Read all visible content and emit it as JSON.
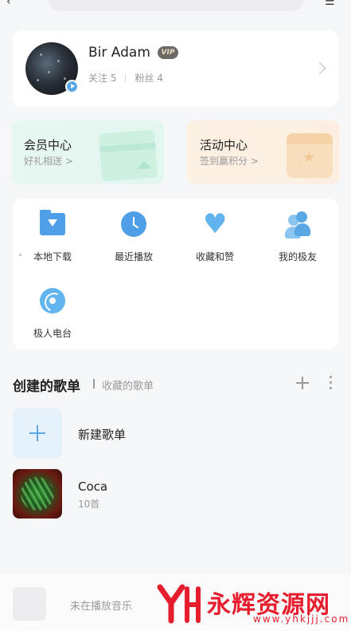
{
  "profile": {
    "username": "Bir Adam",
    "vip_badge": "VIP",
    "following": "关注 5",
    "followers": "粉丝 4"
  },
  "promos": [
    {
      "title": "会员中心",
      "subtitle": "好礼相送 >"
    },
    {
      "title": "活动中心",
      "subtitle": "签到赢积分 >"
    }
  ],
  "grid": [
    {
      "label": "本地下载",
      "icon": "download-folder-icon"
    },
    {
      "label": "最近播放",
      "icon": "clock-icon"
    },
    {
      "label": "收藏和赞",
      "icon": "heart-icon"
    },
    {
      "label": "我的极友",
      "icon": "friends-icon"
    },
    {
      "label": "极人电台",
      "icon": "radio-icon"
    }
  ],
  "playlists": {
    "tab_created": "创建的歌单",
    "tab_collected": "收藏的歌单",
    "new_label": "新建歌单",
    "items": [
      {
        "title": "Coca",
        "count": "10首"
      }
    ]
  },
  "player": {
    "status": "未在播放音乐"
  },
  "watermark": {
    "brand": "永辉资源网",
    "url": "www.yhkjjj.com"
  },
  "colors": {
    "accent": "#5aa7e6",
    "watermark": "#e61d2d"
  }
}
